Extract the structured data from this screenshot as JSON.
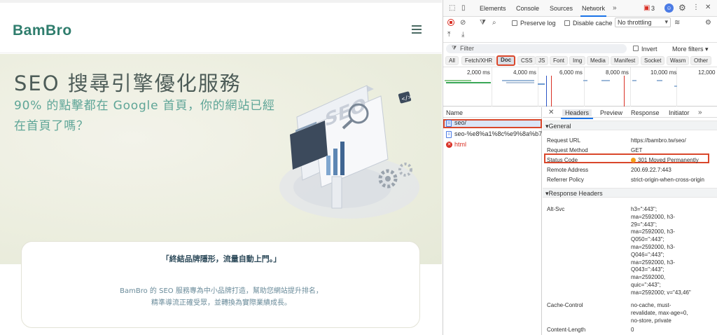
{
  "site": {
    "logo": "BamBro",
    "hero_title": "SEO 搜尋引擎優化服務",
    "hero_sub_line1_pre": "90% 的點擊都在 Google 首頁，你的網站已經",
    "hero_sub_line2": "在首頁了嗎？",
    "illustration_label": "SEO",
    "card_headline": "「終結品牌隱形，流量自動上門。」",
    "card_body_line1": "BamBro 的 SEO 服務專為中小品牌打造，幫助您網站提升排名，",
    "card_body_line2": "精準導流正確受眾，並轉換為實際業績成長。"
  },
  "devtools": {
    "tabs": [
      "Elements",
      "Console",
      "Sources",
      "Network"
    ],
    "active_tab": "Network",
    "issues_count": "3",
    "preserve_log": "Preserve log",
    "disable_cache": "Disable cache",
    "throttling": "No throttling",
    "filter_placeholder": "Filter",
    "invert": "Invert",
    "more_filters": "More filters",
    "type_filters": [
      "All",
      "Fetch/XHR",
      "Doc",
      "CSS",
      "JS",
      "Font",
      "Img",
      "Media",
      "Manifest",
      "Socket",
      "Wasm",
      "Other"
    ],
    "selected_type": "Doc",
    "overview_ticks": [
      "2,000 ms",
      "4,000 ms",
      "6,000 ms",
      "8,000 ms",
      "10,000 ms",
      "12,000"
    ],
    "name_header": "Name",
    "requests": [
      {
        "name": "seo/",
        "status": "doc",
        "selected": true
      },
      {
        "name": "seo-%e8%a1%8c%e9%8a%b7...",
        "status": "doc",
        "selected": false
      },
      {
        "name": "html",
        "status": "error",
        "selected": false
      }
    ],
    "detail_tabs": [
      "Headers",
      "Preview",
      "Response",
      "Initiator"
    ],
    "general_title": "General",
    "general": [
      {
        "k": "Request URL",
        "v": "https://bambro.tw/seo/"
      },
      {
        "k": "Request Method",
        "v": "GET"
      },
      {
        "k": "Status Code",
        "v": "301 Moved Permanently"
      },
      {
        "k": "Remote Address",
        "v": "200.69.22.7:443"
      },
      {
        "k": "Referrer Policy",
        "v": "strict-origin-when-cross-origin"
      }
    ],
    "response_headers_title": "Response Headers",
    "alt_svc_key": "Alt-Svc",
    "alt_svc_lines": [
      "h3=\":443\";",
      "ma=2592000, h3-",
      "29=\":443\";",
      "ma=2592000, h3-",
      "Q050=\":443\";",
      "ma=2592000, h3-",
      "Q046=\":443\";",
      "ma=2592000, h3-",
      "Q043=\":443\";",
      "ma=2592000,",
      "quic=\":443\";",
      "ma=2592000; v=\"43,46\""
    ],
    "cache_control_key": "Cache-Control",
    "cache_control_lines": [
      "no-cache, must-",
      "revalidate, max-age=0,",
      "no-store, private"
    ],
    "content_length_key": "Content-Length",
    "content_length_value": "0"
  },
  "colors": {
    "accent_red": "#d9472b",
    "brand_green": "#2f7d6d",
    "hero_sub": "#5ea597",
    "status_orange": "#f29f1b",
    "devtools_blue": "#1a73e8"
  }
}
